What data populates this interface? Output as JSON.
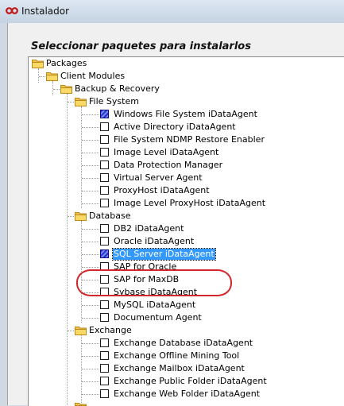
{
  "window": {
    "title": "Instalador"
  },
  "heading": "Seleccionar paquetes para instalarlos",
  "tree": {
    "root": "Packages",
    "client_modules": "Client Modules",
    "backup_recovery": "Backup & Recovery",
    "file_system": {
      "label": "File System",
      "items": [
        {
          "label": "Windows File System iDataAgent",
          "checked": true
        },
        {
          "label": "Active Directory iDataAgent",
          "checked": false
        },
        {
          "label": "File System NDMP Restore Enabler",
          "checked": false
        },
        {
          "label": "Image Level iDataAgent",
          "checked": false
        },
        {
          "label": "Data Protection Manager",
          "checked": false
        },
        {
          "label": "Virtual Server Agent",
          "checked": false
        },
        {
          "label": "ProxyHost iDataAgent",
          "checked": false
        },
        {
          "label": "Image Level ProxyHost iDataAgent",
          "checked": false
        }
      ]
    },
    "database": {
      "label": "Database",
      "items": [
        {
          "label": "DB2 iDataAgent",
          "checked": false
        },
        {
          "label": "Oracle iDataAgent",
          "checked": false
        },
        {
          "label": "SQL Server iDataAgent",
          "checked": true,
          "selected": true
        },
        {
          "label": "SAP for Oracle",
          "checked": false
        },
        {
          "label": "SAP for MaxDB",
          "checked": false
        },
        {
          "label": "Sybase iDataAgent",
          "checked": false
        },
        {
          "label": "MySQL iDataAgent",
          "checked": false
        },
        {
          "label": "Documentum Agent",
          "checked": false
        }
      ]
    },
    "exchange": {
      "label": "Exchange",
      "items": [
        {
          "label": "Exchange Database iDataAgent",
          "checked": false
        },
        {
          "label": "Exchange Offline Mining Tool",
          "checked": false
        },
        {
          "label": "Exchange Mailbox iDataAgent",
          "checked": false
        },
        {
          "label": "Exchange Public Folder iDataAgent",
          "checked": false
        },
        {
          "label": "Exchange Web Folder iDataAgent",
          "checked": false
        }
      ]
    }
  },
  "colors": {
    "selection": "#3399ff",
    "highlight_annotation": "#d0282b",
    "checked_fill": "#2a2dcf"
  }
}
